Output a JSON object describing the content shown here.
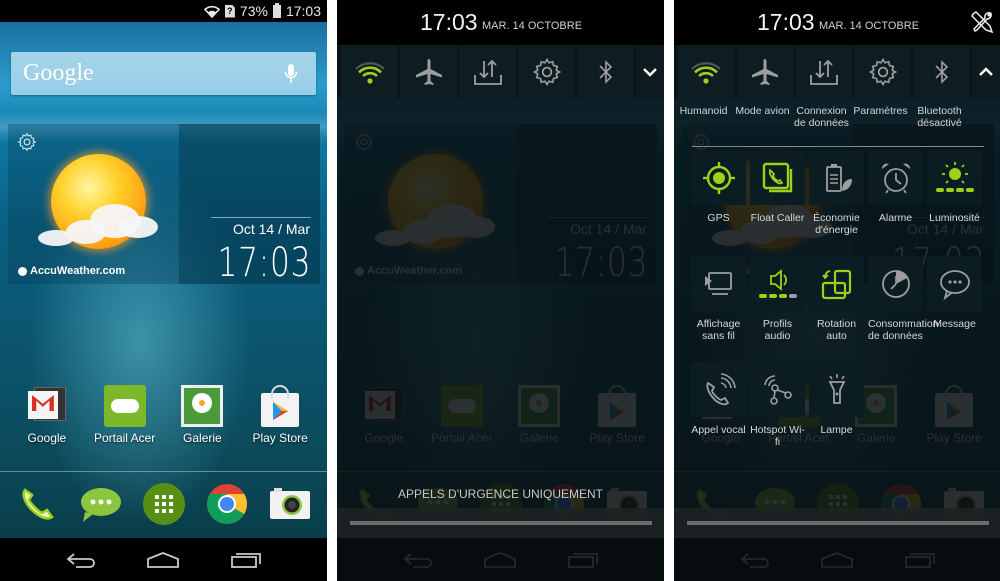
{
  "colors": {
    "accent_green": "#9ad219",
    "icon_gray": "#9e9e9e",
    "shade_bg": "#0b1518"
  },
  "home": {
    "status_bar": {
      "icons": [
        "wifi-icon",
        "sim-unknown-icon",
        "battery-icon"
      ],
      "battery": "73%",
      "time": "17:03"
    },
    "search": {
      "label": "Google",
      "mic_icon": "microphone-icon"
    },
    "weather": {
      "settings_icon": "gear-icon",
      "condition_icon": "partly-sunny-icon",
      "provider": "AccuWeather.com",
      "date": "Oct 14 / Mar",
      "time_hours": "17",
      "time_minutes": "03"
    },
    "apps": [
      {
        "label": "Google",
        "icon": "google-folder-icon"
      },
      {
        "label": "Portail Acer",
        "icon": "acer-portal-icon"
      },
      {
        "label": "Galerie",
        "icon": "gallery-icon"
      },
      {
        "label": "Play Store",
        "icon": "play-store-icon"
      }
    ],
    "dock": [
      {
        "name": "phone",
        "icon": "phone-icon"
      },
      {
        "name": "messaging",
        "icon": "messaging-icon"
      },
      {
        "name": "app-drawer",
        "icon": "app-drawer-icon"
      },
      {
        "name": "chrome",
        "icon": "chrome-icon"
      },
      {
        "name": "camera",
        "icon": "camera-icon"
      }
    ],
    "nav": [
      "back-icon",
      "home-icon",
      "recents-icon"
    ]
  },
  "shade_collapsed": {
    "time": "17:03",
    "date": "MAR. 14 OCTOBRE",
    "toggles": [
      {
        "name": "wifi",
        "icon": "wifi-icon",
        "active": true
      },
      {
        "name": "airplane",
        "icon": "airplane-icon",
        "active": false
      },
      {
        "name": "data",
        "icon": "data-transfer-icon",
        "active": false
      },
      {
        "name": "settings",
        "icon": "gear-icon",
        "active": false
      },
      {
        "name": "bluetooth",
        "icon": "bluetooth-icon",
        "active": false
      }
    ],
    "expand_icon": "chevron-down-icon",
    "emergency_text": "APPELS D'URGENCE UNIQUEMENT"
  },
  "shade_expanded": {
    "time": "17:03",
    "date": "MAR. 14 OCTOBRE",
    "settings_shortcut_icon": "tools-icon",
    "toggles": [
      {
        "name": "wifi",
        "icon": "wifi-icon",
        "label": "Humanoid",
        "active": true
      },
      {
        "name": "airplane",
        "icon": "airplane-icon",
        "label": "Mode avion",
        "active": false
      },
      {
        "name": "data",
        "icon": "data-transfer-icon",
        "label": "Connexion de données",
        "active": false
      },
      {
        "name": "settings",
        "icon": "gear-icon",
        "label": "Paramètres",
        "active": false
      },
      {
        "name": "bluetooth",
        "icon": "bluetooth-icon",
        "label": "Bluetooth désactivé",
        "active": false
      }
    ],
    "collapse_icon": "chevron-up-icon",
    "grid": [
      [
        {
          "label": "GPS",
          "icon": "gps-icon",
          "active": true
        },
        {
          "label": "Float Caller",
          "icon": "float-caller-icon",
          "active": true
        },
        {
          "label": "Économie d'énergie",
          "icon": "power-saving-icon",
          "active": false
        },
        {
          "label": "Alarme",
          "icon": "alarm-clock-icon",
          "active": false
        },
        {
          "label": "Luminosité",
          "icon": "brightness-icon",
          "active": true
        }
      ],
      [
        {
          "label": "Affichage sans fil",
          "icon": "wireless-display-icon",
          "active": false
        },
        {
          "label": "Profils audio",
          "icon": "audio-profile-icon",
          "active": true
        },
        {
          "label": "Rotation auto",
          "icon": "auto-rotate-icon",
          "active": true
        },
        {
          "label": "Consommation de données",
          "icon": "data-usage-icon",
          "active": false
        },
        {
          "label": "Message",
          "icon": "message-icon",
          "active": false
        }
      ],
      [
        {
          "label": "Appel vocal",
          "icon": "voice-call-icon",
          "active": false
        },
        {
          "label": "Hotspot Wi-fi",
          "icon": "hotspot-icon",
          "active": false
        },
        {
          "label": "Lampe",
          "icon": "flashlight-icon",
          "active": false
        }
      ]
    ]
  }
}
